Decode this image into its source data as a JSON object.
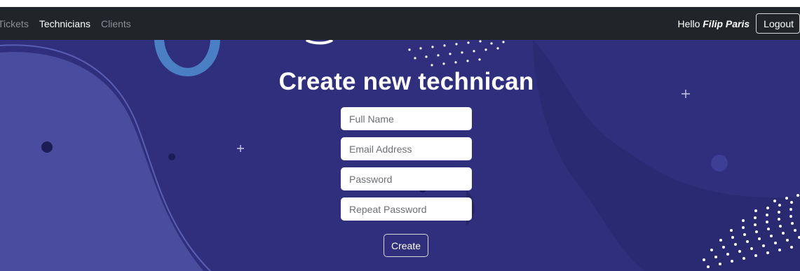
{
  "navbar": {
    "links": [
      {
        "label": "Tickets"
      },
      {
        "label": "Technicians"
      },
      {
        "label": "Clients"
      }
    ],
    "greeting": "Hello",
    "user_name": "Filip Paris",
    "logout_label": "Logout"
  },
  "form": {
    "title": "Create new technican",
    "full_name_placeholder": "Full Name",
    "email_placeholder": "Email Address",
    "password_placeholder": "Password",
    "repeat_password_placeholder": "Repeat Password",
    "submit_label": "Create"
  },
  "colors": {
    "navbar_bg": "#212529",
    "hero_bg": "#2f2f7d",
    "left_wave": "#4a4d9f",
    "accent_ring": "#4b7fc4"
  }
}
